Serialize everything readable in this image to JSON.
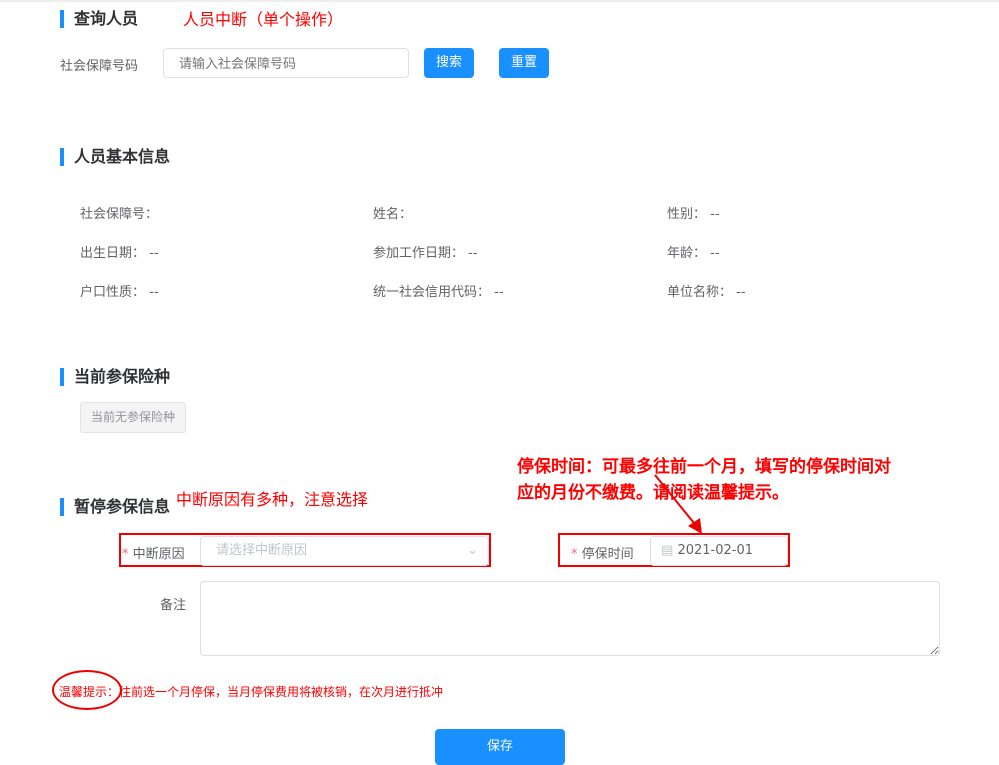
{
  "annotations": {
    "title": "人员中断（单个操作）",
    "reason_note": "中断原因有多种，注意选择",
    "time_note_1": "停保时间：可最多往前一个月，填写的停保时间对",
    "time_note_2": "应的月份不缴费。请阅读温馨提示。"
  },
  "query": {
    "title": "查询人员",
    "label": "社会保障号码",
    "placeholder": "请输入社会保障号码",
    "search": "搜索",
    "reset": "重置"
  },
  "basic": {
    "title": "人员基本信息",
    "fields": [
      {
        "label": "社会保障号：",
        "value": ""
      },
      {
        "label": "姓名：",
        "value": ""
      },
      {
        "label": "性别：",
        "value": "--"
      },
      {
        "label": "出生日期：",
        "value": "--"
      },
      {
        "label": "参加工作日期：",
        "value": "--"
      },
      {
        "label": "年龄：",
        "value": "--"
      },
      {
        "label": "户口性质：",
        "value": "--"
      },
      {
        "label": "统一社会信用代码：",
        "value": "--"
      },
      {
        "label": "单位名称：",
        "value": "--"
      }
    ]
  },
  "current": {
    "title": "当前参保险种",
    "none": "当前无参保险种"
  },
  "suspend": {
    "title": "暂停参保信息",
    "reason_label": "中断原因",
    "reason_placeholder": "请选择中断原因",
    "time_label": "停保时间",
    "time_value": "2021-02-01",
    "remark_label": "备注",
    "tip_label": "温馨提示",
    "tip_text": "：往前选一个月停保，当月停保费用将被核销，在次月进行抵冲",
    "save": "保存",
    "required": "*"
  }
}
